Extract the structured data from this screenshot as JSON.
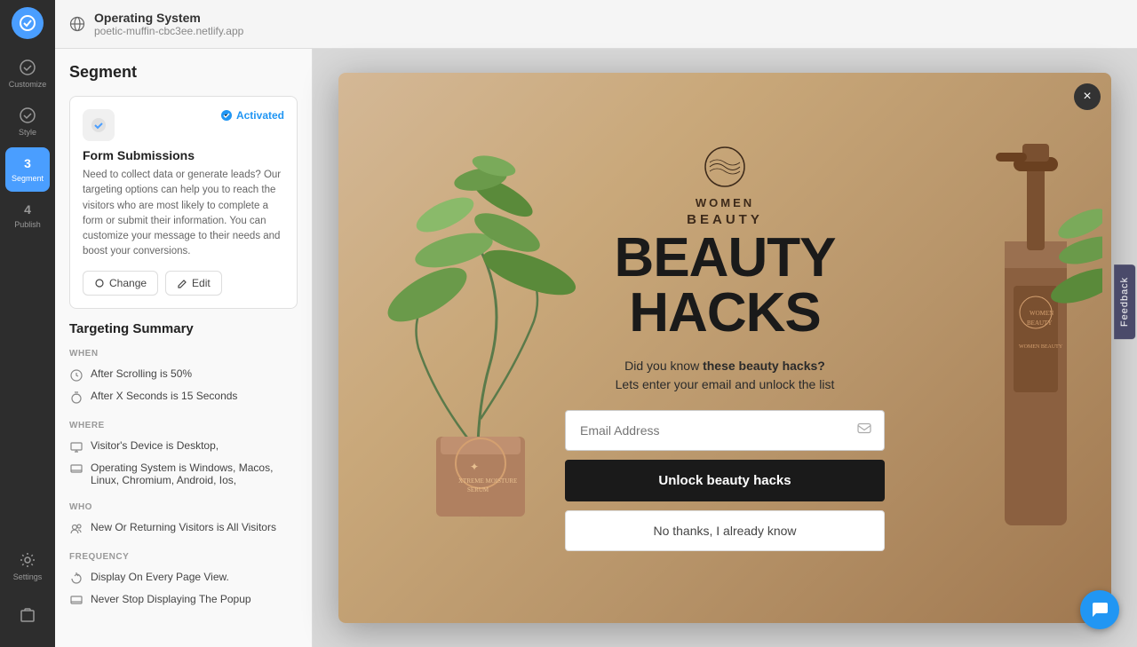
{
  "app": {
    "title": "Operating System",
    "subtitle": "poetic-muffin-cbc3ee.netlify.app"
  },
  "sidebar": {
    "items": [
      {
        "label": "Customize",
        "icon": "check-circle"
      },
      {
        "label": "Style",
        "icon": "check-circle"
      },
      {
        "label": "Segment",
        "icon": "3",
        "active": true
      },
      {
        "label": "Publish",
        "icon": "4"
      },
      {
        "label": "Settings",
        "icon": "gear"
      }
    ]
  },
  "segment": {
    "title": "Segment",
    "badge": "Activated",
    "card": {
      "title": "Form Submissions",
      "description": "Need to collect data or generate leads? Our targeting options can help you to reach the visitors who are most likely to complete a form or submit their information. You can customize your message to their needs and boost your conversions.",
      "actions": {
        "change": "Change",
        "edit": "Edit"
      }
    },
    "targeting": {
      "title": "Targeting Summary",
      "when_label": "WHEN",
      "when_items": [
        "After Scrolling is 50%",
        "After X Seconds is 15 Seconds"
      ],
      "where_label": "WHERE",
      "where_items": [
        "Visitor's Device is Desktop,",
        "Operating System is Windows, Macos, Linux, Chromium, Android, Ios,"
      ],
      "who_label": "WHO",
      "who_items": [
        "New Or Returning Visitors is All Visitors"
      ],
      "frequency_label": "FREQUENCY",
      "frequency_items": [
        "Display On Every Page View.",
        "Never Stop Displaying The Popup"
      ]
    }
  },
  "popup": {
    "brand_line1": "WOMEN",
    "brand_line2": "BEAUTY",
    "main_title": "BEAUTY HACKS",
    "tagline_normal": "Did you know ",
    "tagline_bold": "these beauty hacks?",
    "tagline2": "Lets enter your email and unlock the list",
    "email_placeholder": "Email Address",
    "unlock_btn": "Unlock beauty hacks",
    "no_thanks_btn": "No thanks, I already know",
    "close_btn": "×"
  },
  "feedback": {
    "label": "Feedback"
  }
}
